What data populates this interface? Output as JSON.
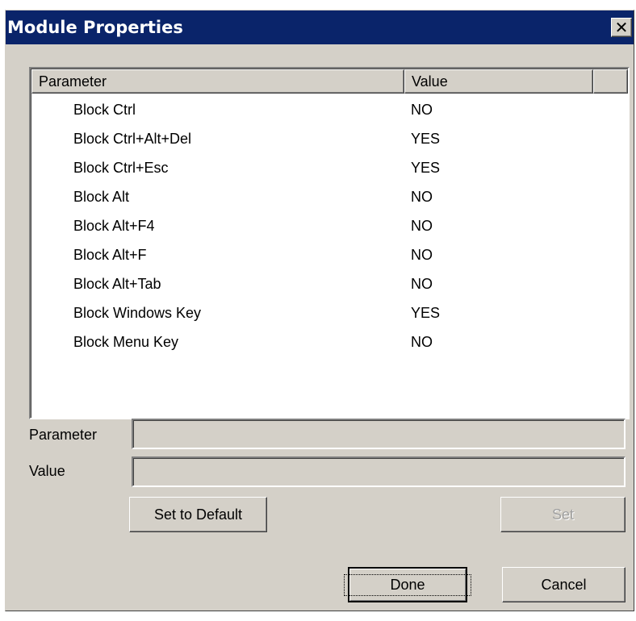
{
  "window": {
    "title": "Module Properties",
    "close_symbol": "✕"
  },
  "list": {
    "columns": [
      "Parameter",
      "Value",
      ""
    ],
    "rows": [
      {
        "parameter": "Block Ctrl",
        "value": "NO"
      },
      {
        "parameter": "Block Ctrl+Alt+Del",
        "value": "YES"
      },
      {
        "parameter": "Block Ctrl+Esc",
        "value": "YES"
      },
      {
        "parameter": "Block Alt",
        "value": "NO"
      },
      {
        "parameter": "Block Alt+F4",
        "value": "NO"
      },
      {
        "parameter": "Block Alt+F",
        "value": "NO"
      },
      {
        "parameter": "Block Alt+Tab",
        "value": "NO"
      },
      {
        "parameter": "Block Windows Key",
        "value": "YES"
      },
      {
        "parameter": "Block Menu Key",
        "value": "NO"
      }
    ]
  },
  "fields": {
    "parameter_label": "Parameter",
    "parameter_value": "",
    "value_label": "Value",
    "value_value": ""
  },
  "buttons": {
    "set_default": "Set to Default",
    "set": "Set",
    "done": "Done",
    "cancel": "Cancel"
  },
  "colors": {
    "titlebar": "#0a246a",
    "dialog_bg": "#d4d0c8"
  }
}
